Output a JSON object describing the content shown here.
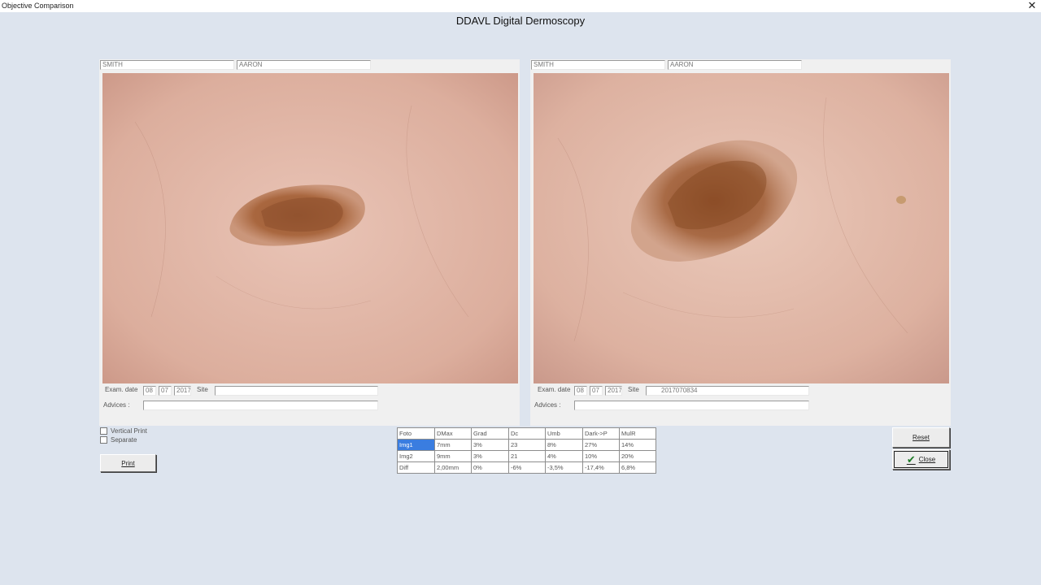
{
  "window": {
    "title": "Objective Comparison",
    "close_glyph": "✕"
  },
  "app": {
    "title": "DDAVL Digital Dermoscopy"
  },
  "left_panel": {
    "surname": "SMITH",
    "name": "AARON",
    "exam_label": "Exam. date",
    "day": "08",
    "month": "07",
    "year": "2017",
    "site_label": "Site",
    "site_value": "",
    "advices_label": "Advices :",
    "advices_value": "",
    "image": "dermoscopy-lesion-image-1"
  },
  "right_panel": {
    "surname": "SMITH",
    "name": "AARON",
    "exam_label": "Exam. date",
    "day": "08",
    "month": "07",
    "year": "2017",
    "site_label": "Site",
    "site_value": "2017070834",
    "advices_label": "Advices :",
    "advices_value": "",
    "image": "dermoscopy-lesion-image-2"
  },
  "options": {
    "vertical_print": "Vertical Print",
    "separate": "Separate",
    "vertical_print_checked": false,
    "separate_checked": false
  },
  "buttons": {
    "print": "Print",
    "reset": "Reset",
    "close": "Close",
    "check_icon": "✔"
  },
  "table": {
    "headers": [
      "Foto",
      "DMax",
      "Grad",
      "Dc",
      "Umb",
      "Dark->P",
      "MulR"
    ],
    "rows": [
      [
        "Img1",
        "7mm",
        "3%",
        "23",
        "8%",
        "27%",
        "14%"
      ],
      [
        "Img2",
        "9mm",
        "3%",
        "21",
        "4%",
        "10%",
        "20%"
      ],
      [
        "Diff",
        "2,00mm",
        "0%",
        "-6%",
        "-3,5%",
        "-17,4%",
        "6,8%"
      ]
    ],
    "selected_cell": "Img1"
  },
  "colors": {
    "background": "#dde4ee",
    "panel": "#f0f0f0",
    "selection": "#3a7de0",
    "check": "#1d7a26"
  }
}
